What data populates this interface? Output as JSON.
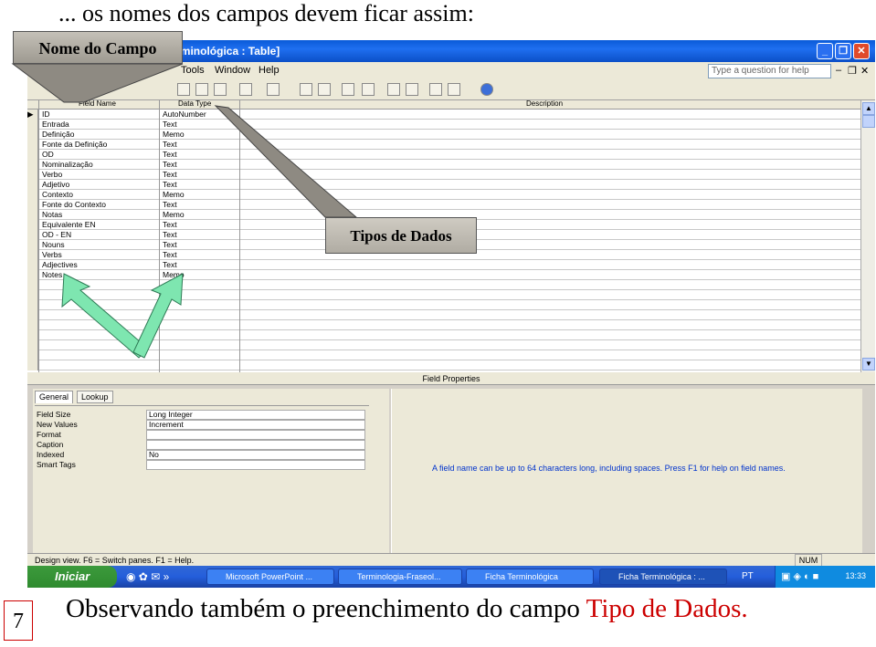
{
  "slide": {
    "top_caption": "... os nomes dos campos devem ficar assim:",
    "bottom_caption_black": "Observando também o preenchimento do campo ",
    "bottom_caption_red": "Tipo de Dados.",
    "page_number": "7",
    "callout_field_name": "Nome do Campo",
    "callout_data_types": "Tipos de Dados"
  },
  "window": {
    "title": "Terminológica : Table]",
    "menu": [
      "Tools",
      "Window",
      "Help"
    ],
    "ask_placeholder": "Type a question for help"
  },
  "grid": {
    "headers": {
      "field": "Field Name",
      "type": "Data Type",
      "desc": "Description"
    },
    "rows": [
      {
        "field": "ID",
        "type": "AutoNumber"
      },
      {
        "field": "Entrada",
        "type": "Text"
      },
      {
        "field": "Definição",
        "type": "Memo"
      },
      {
        "field": "Fonte da Definição",
        "type": "Text"
      },
      {
        "field": "OD",
        "type": "Text"
      },
      {
        "field": "Nominalização",
        "type": "Text"
      },
      {
        "field": "Verbo",
        "type": "Text"
      },
      {
        "field": "Adjetivo",
        "type": "Text"
      },
      {
        "field": "Contexto",
        "type": "Memo"
      },
      {
        "field": "Fonte do Contexto",
        "type": "Text"
      },
      {
        "field": "Notas",
        "type": "Memo"
      },
      {
        "field": "Equivalente EN",
        "type": "Text"
      },
      {
        "field": "OD - EN",
        "type": "Text"
      },
      {
        "field": "Nouns",
        "type": "Text"
      },
      {
        "field": "Verbs",
        "type": "Text"
      },
      {
        "field": "Adjectives",
        "type": "Text"
      },
      {
        "field": "Notes",
        "type": "Memo"
      }
    ]
  },
  "field_properties": {
    "title": "Field Properties",
    "tabs": [
      "General",
      "Lookup"
    ],
    "props": [
      {
        "label": "Field Size",
        "value": "Long Integer"
      },
      {
        "label": "New Values",
        "value": "Increment"
      },
      {
        "label": "Format",
        "value": ""
      },
      {
        "label": "Caption",
        "value": ""
      },
      {
        "label": "Indexed",
        "value": "No"
      },
      {
        "label": "Smart Tags",
        "value": ""
      }
    ],
    "help": "A field name can be up to 64 characters long, including spaces.  Press F1 for help on field names."
  },
  "status": {
    "text": "Design view.  F6 = Switch panes.  F1 = Help.",
    "num": "NUM"
  },
  "taskbar": {
    "start": "Iniciar",
    "tasks": [
      "Microsoft PowerPoint ...",
      "Terminologia-Fraseol...",
      "Ficha Terminológica",
      "Ficha Terminológica : ..."
    ],
    "lang": "PT",
    "clock": "13:33"
  },
  "colors": {
    "accent_red": "#cc0000",
    "arrow_green": "#7ee6b0"
  }
}
